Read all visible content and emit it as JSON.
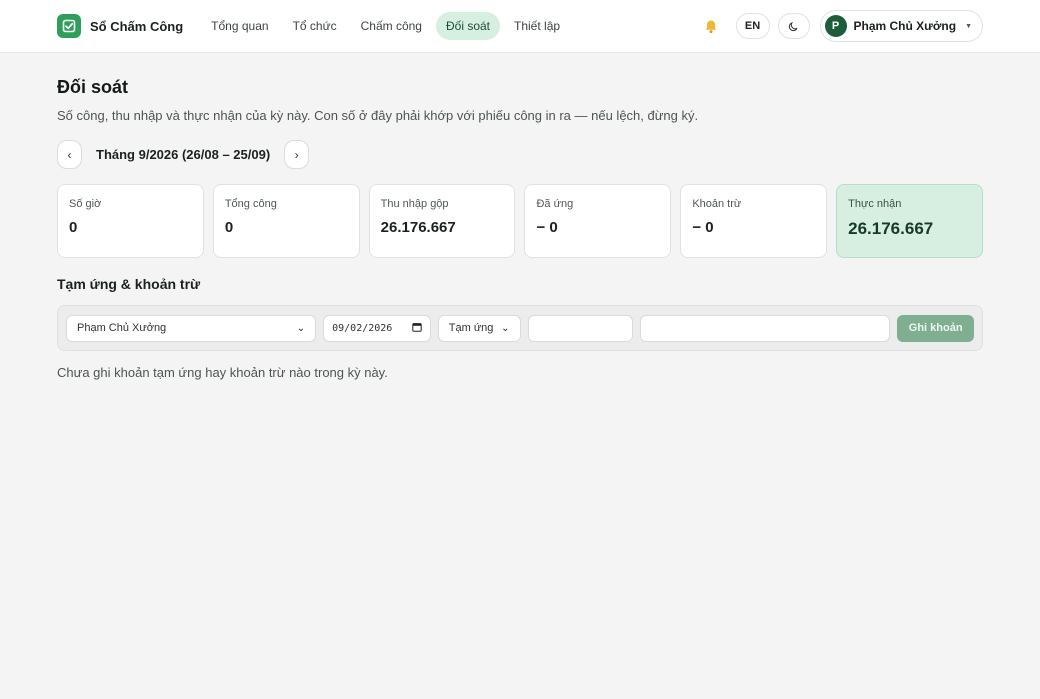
{
  "app": {
    "name": "Sổ Chấm Công"
  },
  "nav": {
    "items": [
      {
        "label": "Tổng quan"
      },
      {
        "label": "Tổ chức"
      },
      {
        "label": "Chấm công"
      },
      {
        "label": "Đối soát",
        "active": true
      },
      {
        "label": "Thiết lập"
      }
    ]
  },
  "toolbar": {
    "lang_label": "EN",
    "user": {
      "initial": "P",
      "name": "Phạm Chủ Xưởng"
    }
  },
  "page": {
    "title": "Đối soát",
    "subtitle": "Số công, thu nhập và thực nhận của kỳ này. Con số ở đây phải khớp với phiếu công in ra — nếu lệch, đừng ký.",
    "period_label": "Tháng 9/2026 (26/08 – 25/09)",
    "prev_label": "‹",
    "next_label": "›"
  },
  "summary": {
    "cards": [
      {
        "label": "Số giờ",
        "value": "0"
      },
      {
        "label": "Tổng công",
        "value": "0"
      },
      {
        "label": "Thu nhập gộp",
        "value": "26.176.667"
      },
      {
        "label": "Đã ứng",
        "value": "− 0"
      },
      {
        "label": "Khoản trừ",
        "value": "− 0"
      },
      {
        "label": "Thực nhận",
        "value": "26.176.667"
      }
    ]
  },
  "advances": {
    "section_title": "Tạm ứng & khoản trừ",
    "form": {
      "person_value": "Phạm Chủ Xưởng",
      "date_value": "09/02/2026",
      "type_value": "Tạm ứng",
      "amount_value": "",
      "note_value": "",
      "submit_label": "Ghi khoản"
    },
    "empty_message": "Chưa ghi khoản tạm ứng hay khoản trừ nào trong kỳ này."
  },
  "colors": {
    "accent": "#2f9e5b",
    "accent_light": "#d6efe0",
    "button_disabled": "#7fae91"
  }
}
